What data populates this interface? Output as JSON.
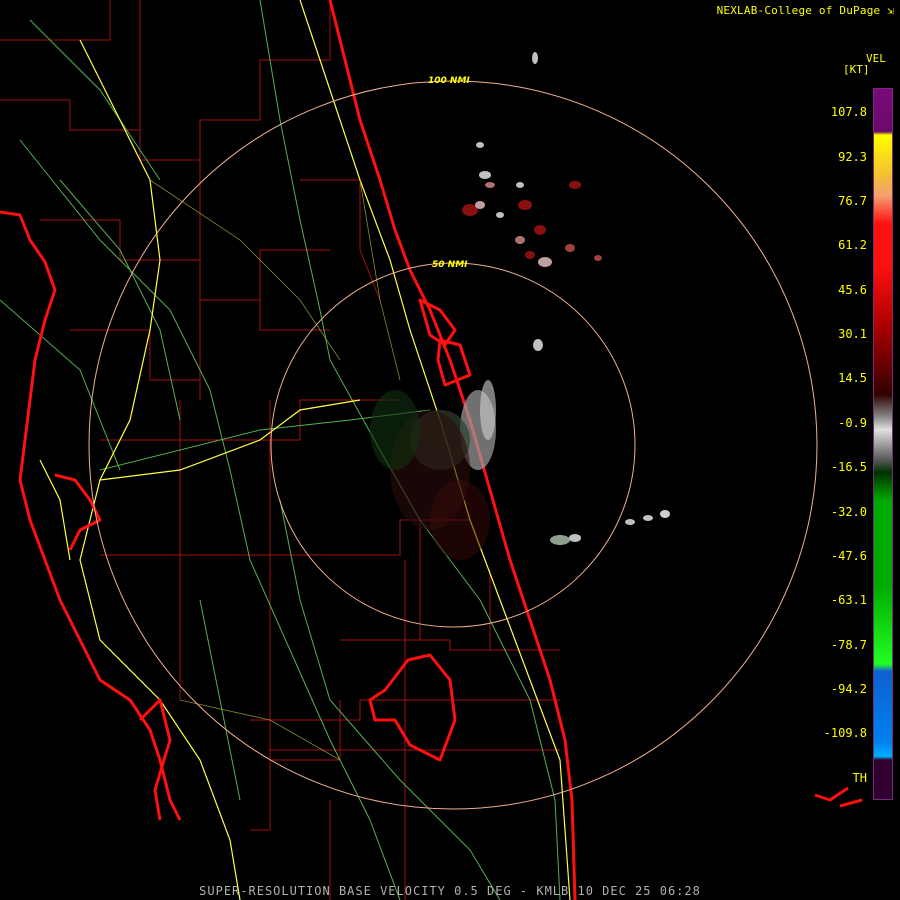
{
  "header": {
    "credit": "NEXLAB-College of DuPage",
    "credit_icon": "external-link-icon"
  },
  "legend": {
    "product": "VEL",
    "unit": "[KT]",
    "ticks": [
      "107.8",
      "92.3",
      "76.7",
      "61.2",
      "45.6",
      "30.1",
      "14.5",
      "-0.9",
      "-16.5",
      "-32.0",
      "-47.6",
      "-63.1",
      "-78.7",
      "-94.2",
      "-109.8",
      "TH"
    ],
    "colors": {
      "purple": "#7a0a7a",
      "yellow": "#ffff00",
      "orange": "#f5a070",
      "red": "#ff1010",
      "darkred": "#5a0000",
      "gray": "#c0c0c0",
      "green": "#00aa00",
      "bright_green": "#22ff22",
      "blue": "#1060d0",
      "cyan_blue": "#00a0ff",
      "range_folded": "#300030"
    }
  },
  "rings": {
    "inner": "50 NMI",
    "outer": "100 NMI"
  },
  "footer": {
    "product_line": "SUPER-RESOLUTION BASE VELOCITY 0.5 DEG - KMLB 10 DEC 25 06:28"
  }
}
